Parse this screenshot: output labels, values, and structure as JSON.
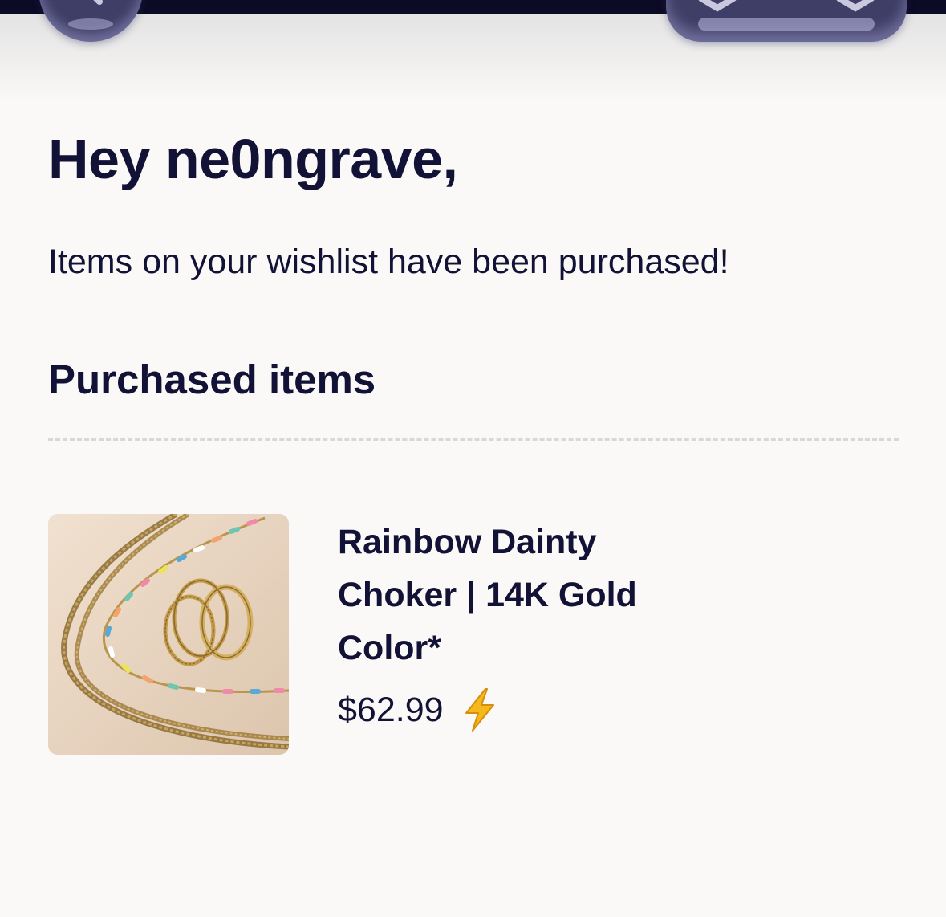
{
  "greeting": "Hey ne0ngrave,",
  "message": "Items on your wishlist have been purchased!",
  "section_title": "Purchased items",
  "items": [
    {
      "name": "Rainbow Dainty Choker | 14K Gold Color*",
      "price": "$62.99",
      "badge_icon": "lightning-bolt-icon",
      "image_icon": "jewelry-photo"
    }
  ],
  "top_bar": {
    "back_icon": "chevron-left-icon",
    "actions": [
      "share-icon",
      "more-icon"
    ]
  },
  "colors": {
    "text": "#121236",
    "background": "#faf9f8",
    "button_fill": "#3f3e66",
    "bolt": "#f6b91c",
    "image_background": "#ead6c3"
  }
}
